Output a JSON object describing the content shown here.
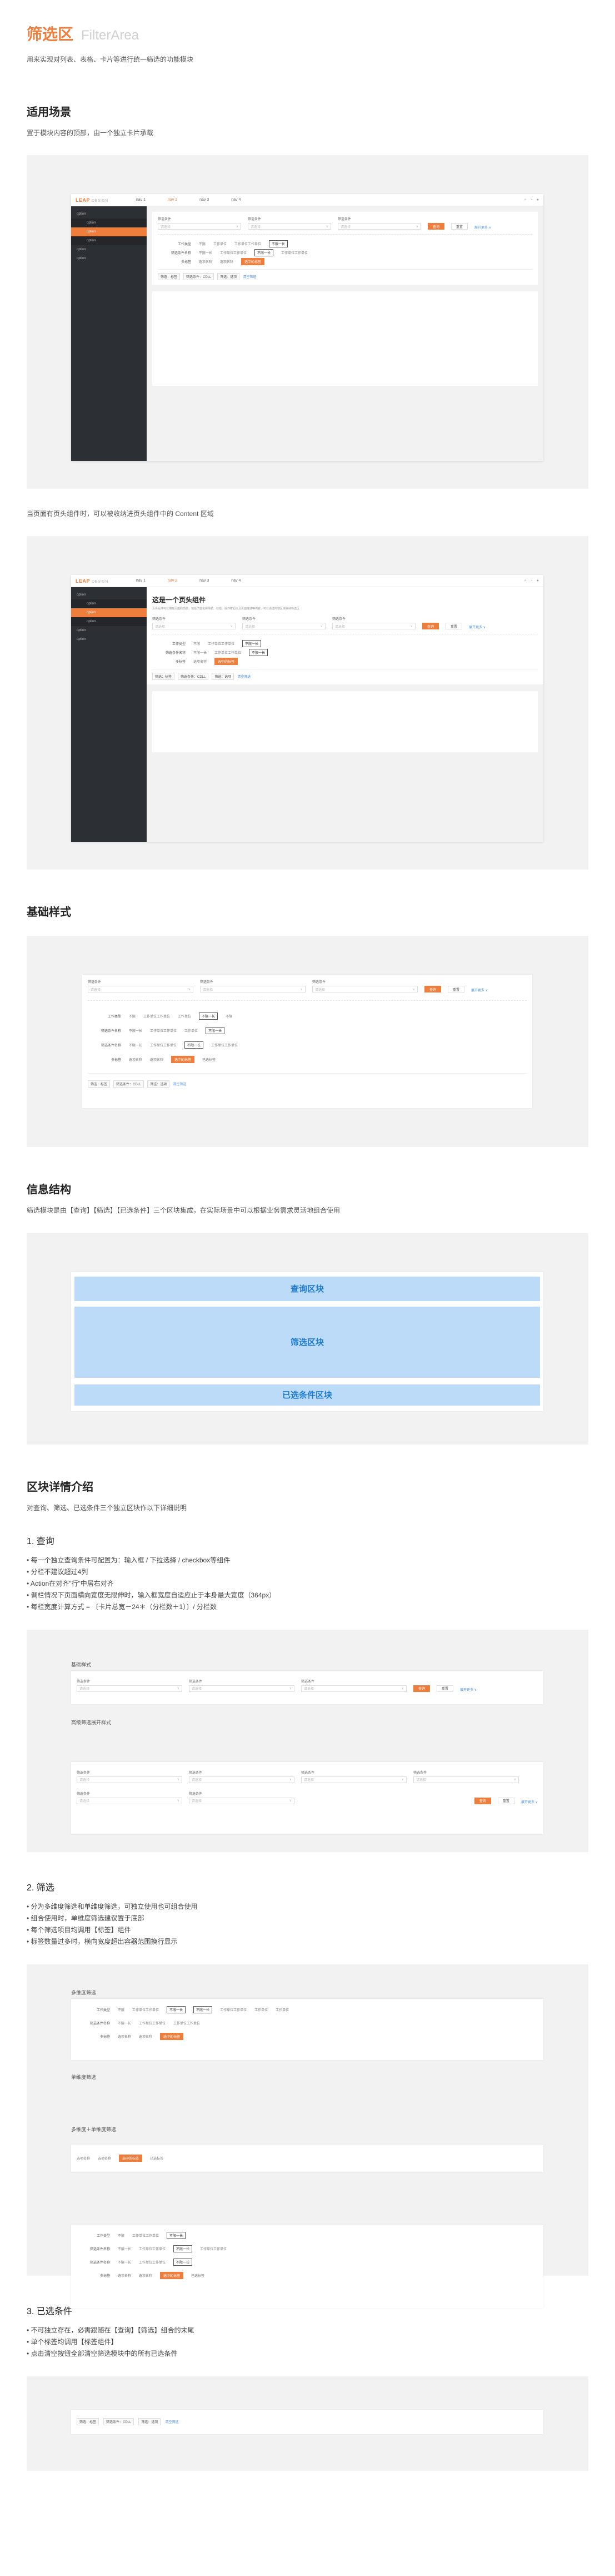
{
  "header": {
    "title_zh": "筛选区",
    "title_en": "FilterArea",
    "lead": "用来实现对列表、表格、卡片等进行统一筛选的功能模块"
  },
  "usage": {
    "heading": "适用场景",
    "p1": "置于模块内容的顶部，由一个独立卡片承载",
    "p2": "当页面有页头组件时，可以被收纳进页头组件中的 Content 区域"
  },
  "app": {
    "logo": "LEAP",
    "logo_sub": "DESIGN",
    "nav": [
      "nav 1",
      "nav 2",
      "nav 3",
      "nav 4"
    ],
    "side": [
      "option",
      "option",
      "option",
      "option",
      "option",
      "option"
    ],
    "pageheader_title": "这是一个页头组件",
    "pageheader_desc": "页头组件可以用在页面的顶部，包括了面包屑导航、标题、操作按钮以及页面描述等内容，可以通过内容区域收纳筛选区"
  },
  "filter": {
    "label": "筛选条件",
    "placeholder": "请选择",
    "search": "查询",
    "reset": "重置",
    "expand": "展开更多 ∨",
    "rows": [
      {
        "k": "工作类型",
        "opts": [
          "不限",
          "全部",
          "工作单位",
          "工作单位工作单位",
          "不限一长",
          "不限"
        ]
      },
      {
        "k": "筛选条件名称",
        "opts": [
          "不限一长",
          "工作单位工作单位",
          "不限一长",
          "工作单位",
          "工作单位工作单位",
          "工作单位"
        ]
      },
      {
        "k": "多标签",
        "opts": [
          "选项名称",
          "选项名称",
          "选中的标签",
          "已选标签"
        ]
      }
    ],
    "chips": [
      "筛选：标签",
      "筛选条件：CDLL",
      "筛选：选项",
      "清空筛选"
    ]
  },
  "basic": {
    "heading": "基础样式"
  },
  "info": {
    "heading": "信息结构",
    "p": "筛选模块是由【查询】【筛选】【已选条件】三个区块集成，在实际场景中可以根据业务需求灵活地组合使用",
    "query_block": "查询区块",
    "filter_block": "筛选区块",
    "selected_block": "已选条件区块"
  },
  "detail": {
    "heading": "区块详情介绍",
    "p": "对查询、筛选、已选条件三个独立区块作以下详细说明",
    "s1": {
      "title": "1. 查询",
      "bullets": [
        "• 每一个独立查询条件可配置为：输入框 / 下拉选择 / checkbox等组件",
        "• 分栏不建议超过4列",
        "• Action在对齐\"行\"中居右对齐",
        "• 调栏情况下页面横向宽度无限伸时，输入框宽度自适应止于本身最大宽度（364px）",
        "• 每栏宽度计算方式 = 〔卡片总宽－24＊（分栏数＋1）〕/ 分栏数"
      ],
      "lb1": "基础样式",
      "lb2": "高级筛选展开样式"
    },
    "s2": {
      "title": "2. 筛选",
      "bullets": [
        "• 分为多维度筛选和单维度筛选，可独立使用也可组合使用",
        "• 组合使用时，单维度筛选建议置于底部",
        "• 每个筛选项目均调用【标签】组件",
        "• 标签数量过多时，横向宽度超出容器范围换行显示"
      ],
      "lb1": "多维度筛选",
      "lb2": "单维度筛选",
      "lb3": "多维度＋单维度筛选"
    },
    "s3": {
      "title": "3. 已选条件",
      "bullets": [
        "• 不可独立存在，必需跟随在【查询】【筛选】组合的末尾",
        "• 单个标签均调用【标签组件】",
        "• 点击清空按钮全部清空筛选模块中的所有已选条件"
      ]
    }
  }
}
